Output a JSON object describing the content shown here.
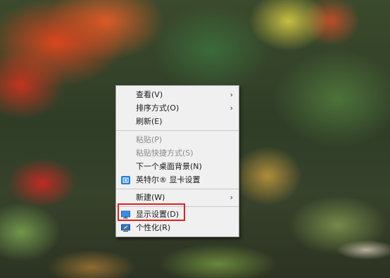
{
  "context_menu": {
    "items": [
      {
        "label": "查看(V)",
        "submenu": true
      },
      {
        "label": "排序方式(O)",
        "submenu": true
      },
      {
        "label": "刷新(E)"
      },
      {
        "label": "粘贴(P)",
        "disabled": true
      },
      {
        "label": "粘贴快捷方式(S)",
        "disabled": true
      },
      {
        "label": "下一个桌面背景(N)"
      },
      {
        "label": "英特尔® 显卡设置",
        "icon": "intel-graphics-icon"
      },
      {
        "label": "新建(W)",
        "submenu": true
      },
      {
        "label": "显示设置(D)",
        "icon": "display-settings-icon",
        "highlighted": true
      },
      {
        "label": "个性化(R)",
        "icon": "personalize-icon"
      }
    ],
    "submenu_arrow": "›"
  },
  "colors": {
    "menu_bg": "#f0f0f0",
    "highlight_box": "#e02020",
    "disabled_text": "#8a8a8a"
  }
}
